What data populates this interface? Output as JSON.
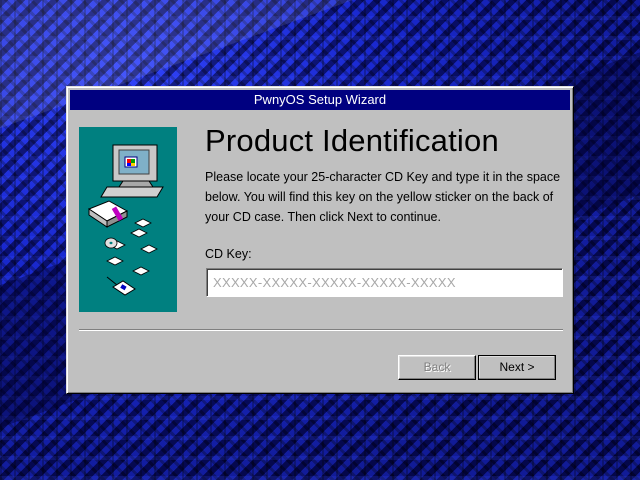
{
  "window": {
    "title": "PwnyOS Setup Wizard"
  },
  "page": {
    "heading": "Product Identification",
    "instructions": "Please locate your 25-character CD Key and type it in the space below. You will find this key on the yellow sticker on the back of your CD case. Then click Next to continue."
  },
  "cdkey": {
    "label": "CD Key:",
    "placeholder": "XXXXX-XXXXX-XXXXX-XXXXX-XXXXX",
    "value": ""
  },
  "buttons": {
    "back_label": "Back",
    "back_enabled": false,
    "next_label": "Next >"
  },
  "colors": {
    "title_bar": "#000080",
    "panel_teal": "#008080",
    "window_face": "#c0c0c0",
    "desktop": "#0a0f6e"
  },
  "icons": {
    "illustration": "computer-with-floppy-and-cd-icon"
  }
}
